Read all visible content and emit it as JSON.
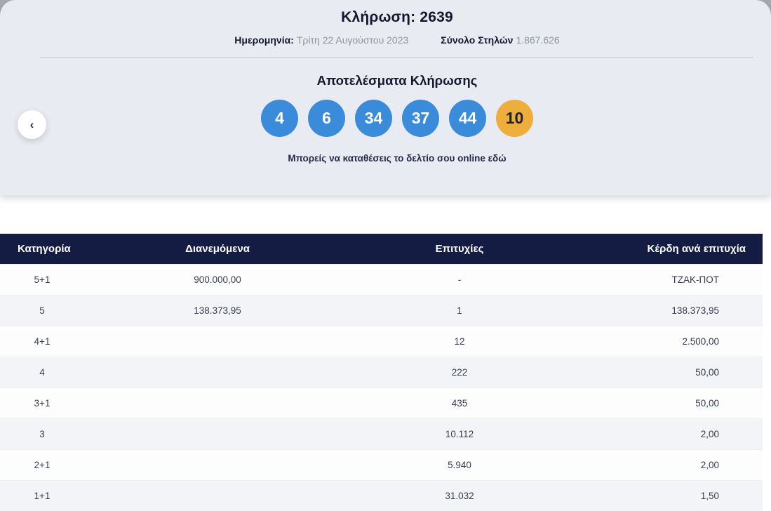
{
  "colors": {
    "ball_blue": "#3A8BD9",
    "ball_bonus": "#EDAE3C",
    "table_header_bg": "#151C44",
    "card_bg": "#E9EBF2",
    "backdrop": "#A6A8AD"
  },
  "card": {
    "title": "Κλήρωση: 2639",
    "date_label": "Ημερομηνία:",
    "date_value": "Τρίτη 22 Αυγούστου 2023",
    "columns_label": "Σύνολο Στηλών",
    "columns_value": "1.867.626",
    "results_heading": "Αποτελέσματα Κλήρωσης",
    "numbers": [
      "4",
      "6",
      "34",
      "37",
      "44"
    ],
    "bonus_number": "10",
    "cta_text": "Μπορείς να καταθέσεις το δελτίο σου online",
    "cta_link_label": "εδώ"
  },
  "nav": {
    "prev_button_icon": "‹"
  },
  "results_table": {
    "headers": [
      "Κατηγορία",
      "Διανεμόμενα",
      "Επιτυχίες",
      "Κέρδη ανά επιτυχία"
    ],
    "rows": [
      {
        "category": "5+1",
        "distributed": "900.000,00",
        "winners": "-",
        "prize": "ΤΖΑΚ-ΠΟΤ"
      },
      {
        "category": "5",
        "distributed": "138.373,95",
        "winners": "1",
        "prize": "138.373,95"
      },
      {
        "category": "4+1",
        "distributed": "",
        "winners": "12",
        "prize": "2.500,00"
      },
      {
        "category": "4",
        "distributed": "",
        "winners": "222",
        "prize": "50,00"
      },
      {
        "category": "3+1",
        "distributed": "",
        "winners": "435",
        "prize": "50,00"
      },
      {
        "category": "3",
        "distributed": "",
        "winners": "10.112",
        "prize": "2,00"
      },
      {
        "category": "2+1",
        "distributed": "",
        "winners": "5.940",
        "prize": "2,00"
      },
      {
        "category": "1+1",
        "distributed": "",
        "winners": "31.032",
        "prize": "1,50"
      }
    ]
  }
}
